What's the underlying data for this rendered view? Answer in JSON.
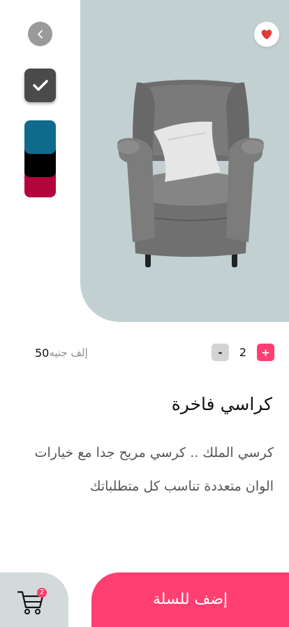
{
  "colors": {
    "hero_bg": "#c2d0d2",
    "accent": "#ff3f72",
    "swatches": [
      "#4a4a4a",
      "#0e6b8c",
      "#000000",
      "#b3053b"
    ]
  },
  "nav": {
    "back_icon": "chevron-left-icon",
    "favorite_icon": "heart-icon",
    "favorite_active": true
  },
  "product": {
    "title": "كراسي فاخرة",
    "description": "كرسي الملك .. كرسي مريح جدا مع خيارات الوان متعددة تناسب كل متطلباتك",
    "price_value": "50",
    "price_unit": "إلف جنيه",
    "image_icon": "armchair-image"
  },
  "quantity": {
    "minus_label": "-",
    "value": "2",
    "plus_label": "+"
  },
  "bottom": {
    "cart_icon": "cart-icon",
    "cart_count": "2",
    "add_to_cart_label": "إضف للسلة"
  }
}
